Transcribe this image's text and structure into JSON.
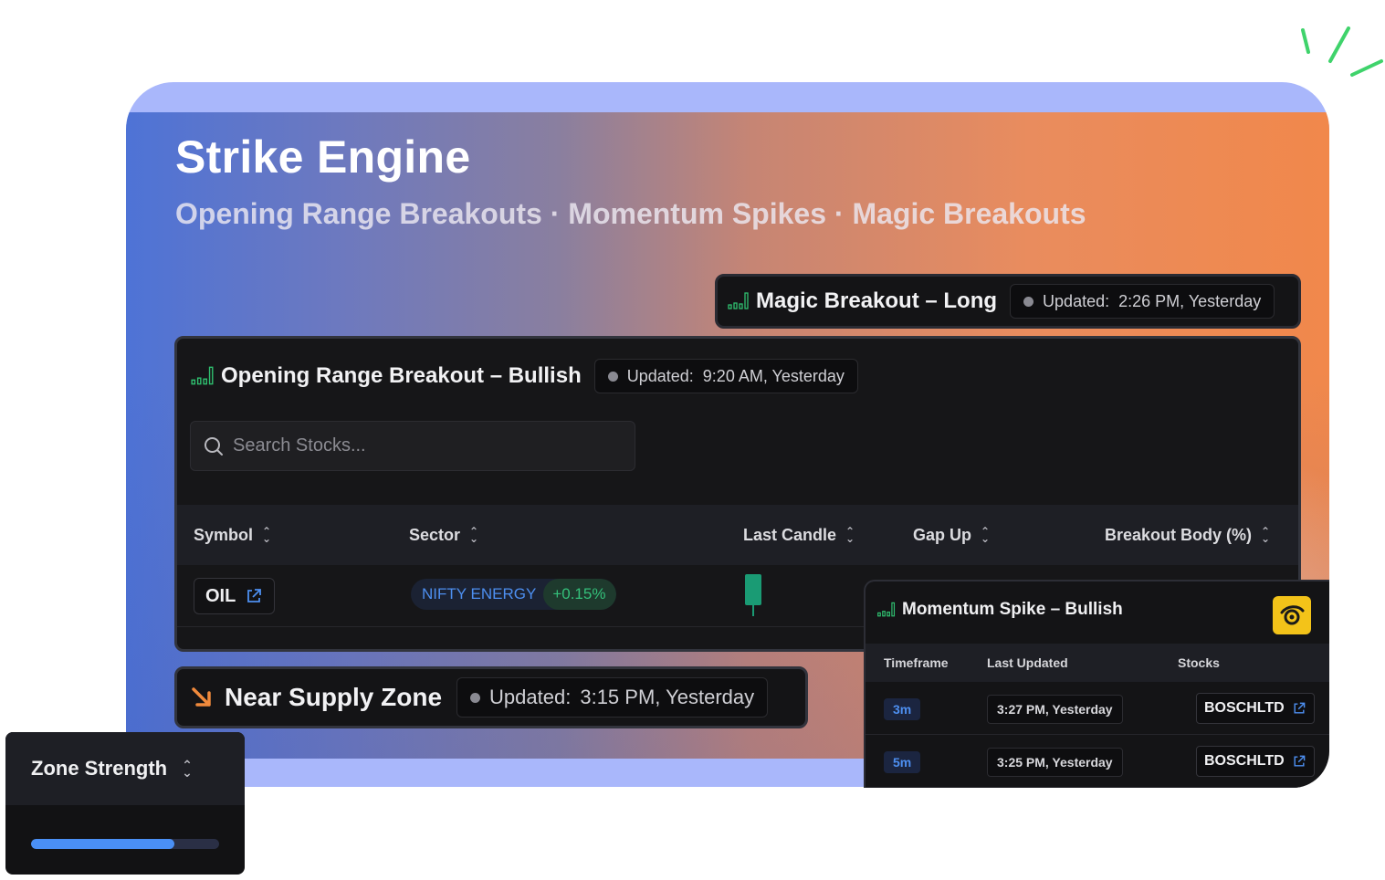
{
  "hero": {
    "title": "Strike Engine",
    "subtitle": "Opening Range Breakouts · Momentum Spikes · Magic Breakouts"
  },
  "magic_breakout": {
    "label": "Magic Breakout – Long",
    "updated_prefix": "Updated:",
    "updated_time": "2:26 PM, Yesterday"
  },
  "orb": {
    "label": "Opening Range Breakout – Bullish",
    "updated_prefix": "Updated:",
    "updated_time": "9:20 AM, Yesterday",
    "search_placeholder": "Search Stocks...",
    "columns": [
      "Symbol",
      "Sector",
      "Last Candle",
      "Gap Up",
      "Breakout Body (%)"
    ],
    "rows": [
      {
        "symbol": "OIL",
        "sector": "NIFTY ENERGY",
        "sector_change": "+0.15%",
        "candle_color": "#1a9b74"
      }
    ]
  },
  "supply": {
    "label": "Near Supply Zone",
    "updated_prefix": "Updated:",
    "updated_time": "3:15 PM, Yesterday"
  },
  "zone_strength": {
    "label": "Zone Strength",
    "value_fraction": 0.76
  },
  "momentum": {
    "label": "Momentum Spike – Bullish",
    "columns": [
      "Timeframe",
      "Last Updated",
      "Stocks"
    ],
    "rows": [
      {
        "timeframe": "3m",
        "updated": "3:27 PM, Yesterday",
        "stock": "BOSCHLTD"
      },
      {
        "timeframe": "5m",
        "updated": "3:25 PM, Yesterday",
        "stock": "BOSCHLTD"
      }
    ]
  },
  "colors": {
    "accent_blue": "#4d8ff0",
    "positive_green": "#34c07a",
    "supply_arrow": "#f08a3c",
    "owl_badge": "#f3c319"
  }
}
